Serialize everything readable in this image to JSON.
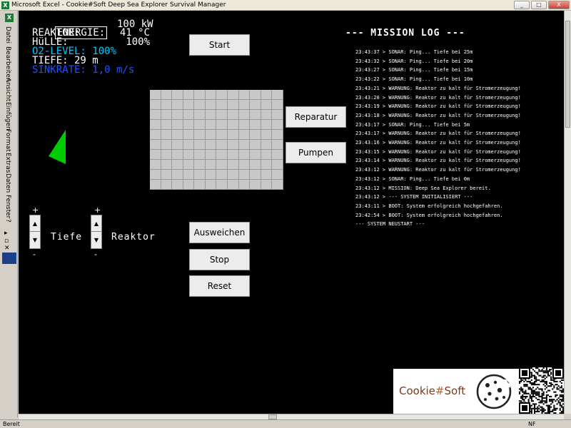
{
  "window": {
    "title": "Microsoft Excel - Cookie#Soft Deep Sea Explorer Survival Manager",
    "app_icon": "excel-icon",
    "controls": [
      "_",
      "□",
      "X"
    ]
  },
  "menu": {
    "items": [
      "Datei",
      "Bearbeiten",
      "Ansicht",
      "Einfügen",
      "Format",
      "Extras",
      "Daten",
      "Fenster",
      "?"
    ]
  },
  "stats": {
    "energy_label": "ENERGIE:",
    "energy_value": "100 kW",
    "reactor_label": "REAKTOR:",
    "reactor_value": "41 °C",
    "hull_label": "HüLLE:",
    "hull_value": "100%",
    "o2_line": "O2-LEVEL: 100%",
    "depth_line": "TIEFE: 29 m",
    "sink_line": "SINKRATE: 1,0 m/s"
  },
  "buttons": {
    "start": "Start",
    "repair": "Reparatur",
    "pump": "Pumpen",
    "evade": "Ausweichen",
    "stop": "Stop",
    "reset": "Reset"
  },
  "spinners": {
    "depth_label": "Tiefe",
    "reactor_label": "Reaktor",
    "plus": "+",
    "minus": "-"
  },
  "log": {
    "title": "--- MISSION LOG ---",
    "lines": [
      "23:43:37 > SONAR: Ping... Tiefe bei 25m",
      "23:43:32 > SONAR: Ping... Tiefe bei 20m",
      "23:43:27 > SONAR: Ping... Tiefe bei 15m",
      "23:43:22 > SONAR: Ping... Tiefe bei 10m",
      "23:43:21 > WARNUNG: Reaktor zu kalt für Stromerzeugung!",
      "23:43:20 > WARNUNG: Reaktor zu kalt für Stromerzeugung!",
      "23:43:19 > WARNUNG: Reaktor zu kalt für Stromerzeugung!",
      "23:43:18 > WARNUNG: Reaktor zu kalt für Stromerzeugung!",
      "23:43:17 > SONAR: Ping... Tiefe bei 5m",
      "23:43:17 > WARNUNG: Reaktor zu kalt für Stromerzeugung!",
      "23:43:16 > WARNUNG: Reaktor zu kalt für Stromerzeugung!",
      "23:43:15 > WARNUNG: Reaktor zu kalt für Stromerzeugung!",
      "23:43:14 > WARNUNG: Reaktor zu kalt für Stromerzeugung!",
      "23:43:12 > WARNUNG: Reaktor zu kalt für Stromerzeugung!",
      "23:43:12 > SONAR: Ping... Tiefe bei 0m",
      "23:43:12 > MISSION: Deep Sea Explorer bereit.",
      "23:43:12 > --- SYSTEM INITIALISIERT ---",
      "23:43:11 > BOOT: System erfolgreich hochgefahren.",
      "23:42:54 > BOOT: System erfolgreich hochgefahren.",
      "--- SYSTEM NEUSTART ---"
    ]
  },
  "logo": {
    "brand_prefix": "Cookie",
    "brand_hash": "#",
    "brand_suffix": "Soft"
  },
  "status": {
    "left": "Bereit",
    "right": "NF"
  },
  "colors": {
    "background": "#000000",
    "o2": "#00c8ff",
    "sinkrate": "#1f55ff",
    "sonar": "#00cc00",
    "grid": "#c8c8c8"
  }
}
